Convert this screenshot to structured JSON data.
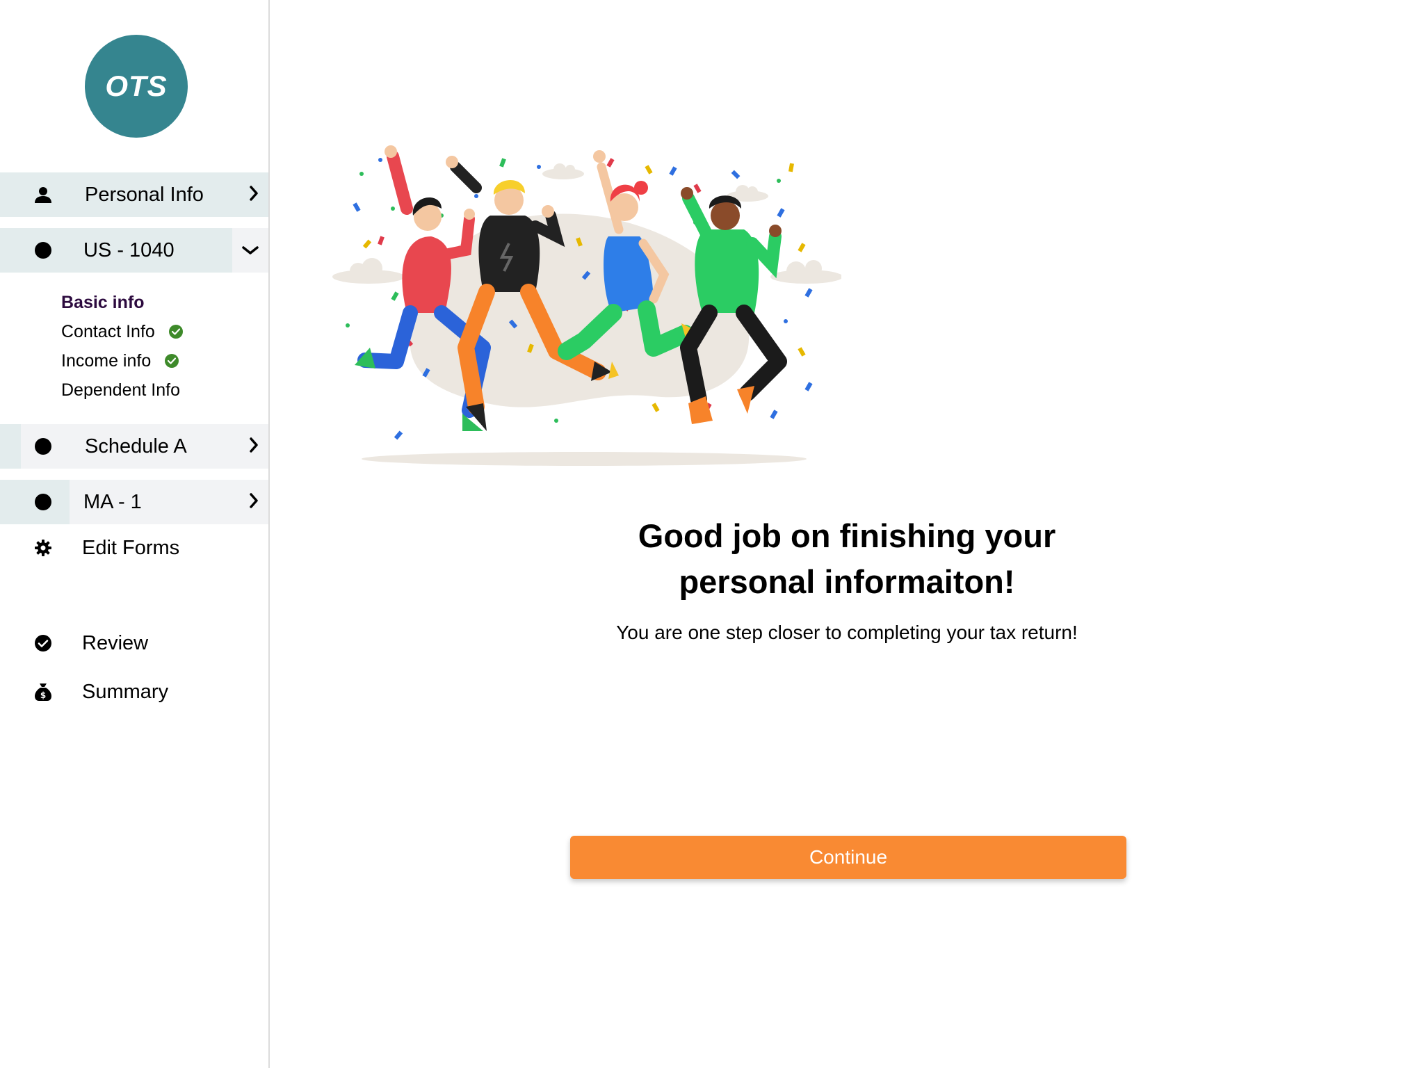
{
  "app": {
    "logo_text": "OTS"
  },
  "sidebar": {
    "items": [
      {
        "label": "Personal Info",
        "icon": "user-icon"
      },
      {
        "label": "US - 1040",
        "icon": "dot-icon"
      },
      {
        "label": "Schedule A",
        "icon": "dot-icon"
      },
      {
        "label": "MA - 1",
        "icon": "dot-icon"
      },
      {
        "label": "Edit Forms",
        "icon": "gear-icon"
      },
      {
        "label": "Review",
        "icon": "check-circle-icon"
      },
      {
        "label": "Summary",
        "icon": "money-bag-icon"
      }
    ],
    "subitems": [
      {
        "label": "Basic info",
        "active": true,
        "completed": false
      },
      {
        "label": "Contact Info",
        "active": false,
        "completed": true
      },
      {
        "label": "Income info",
        "active": false,
        "completed": true
      },
      {
        "label": "Dependent Info",
        "active": false,
        "completed": false
      }
    ]
  },
  "main": {
    "headline_line1": "Good job on finishing your",
    "headline_line2": "personal informaiton!",
    "subtext": "You are one step closer to completing your tax return!",
    "continue_label": "Continue"
  },
  "colors": {
    "accent": "#f98a33",
    "logo": "#35858f",
    "nav_highlight": "#e3eced",
    "nav_secondary": "#f2f3f5",
    "check": "#3e8a2a",
    "active_sub": "#2d0b3f"
  }
}
